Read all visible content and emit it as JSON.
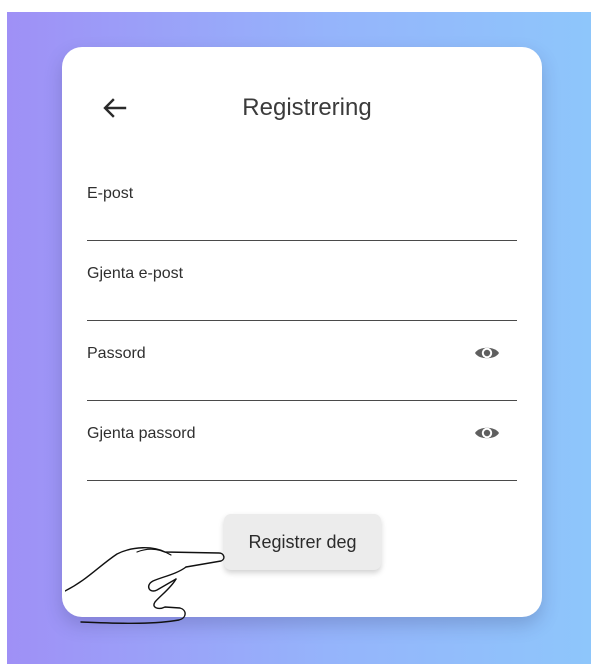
{
  "header": {
    "title": "Registrering",
    "back_icon": "arrow-left-icon"
  },
  "form": {
    "fields": [
      {
        "name": "email",
        "placeholder": "E-post",
        "value": ""
      },
      {
        "name": "confirm-email",
        "placeholder": "Gjenta e-post",
        "value": ""
      },
      {
        "name": "password",
        "placeholder": "Passord",
        "value": "",
        "toggle_icon": "eye-icon"
      },
      {
        "name": "confirm-password",
        "placeholder": "Gjenta passord",
        "value": "",
        "toggle_icon": "eye-icon"
      }
    ],
    "submit_label": "Registrer deg"
  },
  "colors": {
    "background_gradient_start": "#9f90f6",
    "background_gradient_end": "#8ec6fb",
    "card": "#ffffff",
    "button": "#ececec",
    "icon": "#5f5f5f"
  },
  "overlay": {
    "pointer_icon": "pointing-hand-icon"
  }
}
